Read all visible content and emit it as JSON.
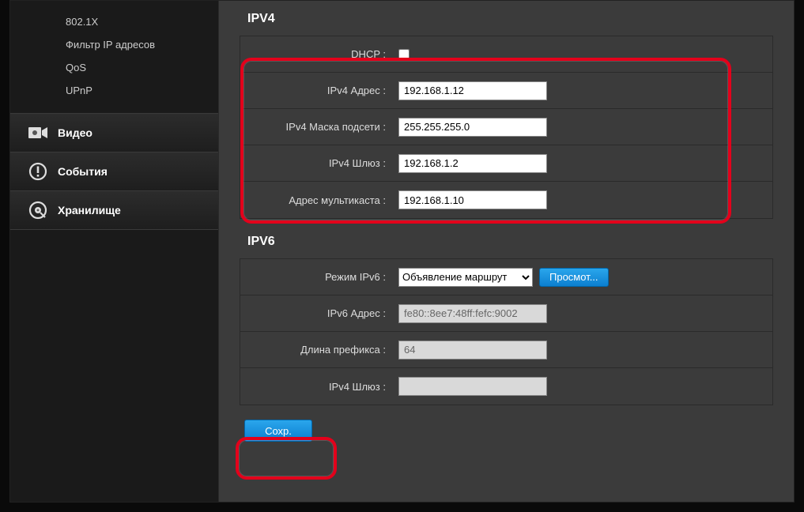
{
  "sidebar": {
    "sub_items": [
      "802.1X",
      "Фильтр IP адресов",
      "QoS",
      "UPnP"
    ],
    "sections": [
      {
        "label": "Видео",
        "icon": "video-icon"
      },
      {
        "label": "События",
        "icon": "alert-icon"
      },
      {
        "label": "Хранилище",
        "icon": "disk-icon"
      }
    ]
  },
  "ipv4": {
    "title": "IPV4",
    "dhcp_label": "DHCP :",
    "address_label": "IPv4 Адрес :",
    "address_value": "192.168.1.12",
    "mask_label": "IPv4 Маска подсети :",
    "mask_value": "255.255.255.0",
    "gateway_label": "IPv4 Шлюз :",
    "gateway_value": "192.168.1.2",
    "multicast_label": "Адрес мультикаста :",
    "multicast_value": "192.168.1.10"
  },
  "ipv6": {
    "title": "IPV6",
    "mode_label": "Режим IPv6 :",
    "mode_value": "Объявление маршрут",
    "view_btn": "Просмот...",
    "address_label": "IPv6 Адрес :",
    "address_value": "fe80::8ee7:48ff:fefc:9002",
    "prefix_label": "Длина префикса :",
    "prefix_value": "64",
    "gateway_label": "IPv4 Шлюз :",
    "gateway_value": ""
  },
  "save_btn": "Сохр."
}
